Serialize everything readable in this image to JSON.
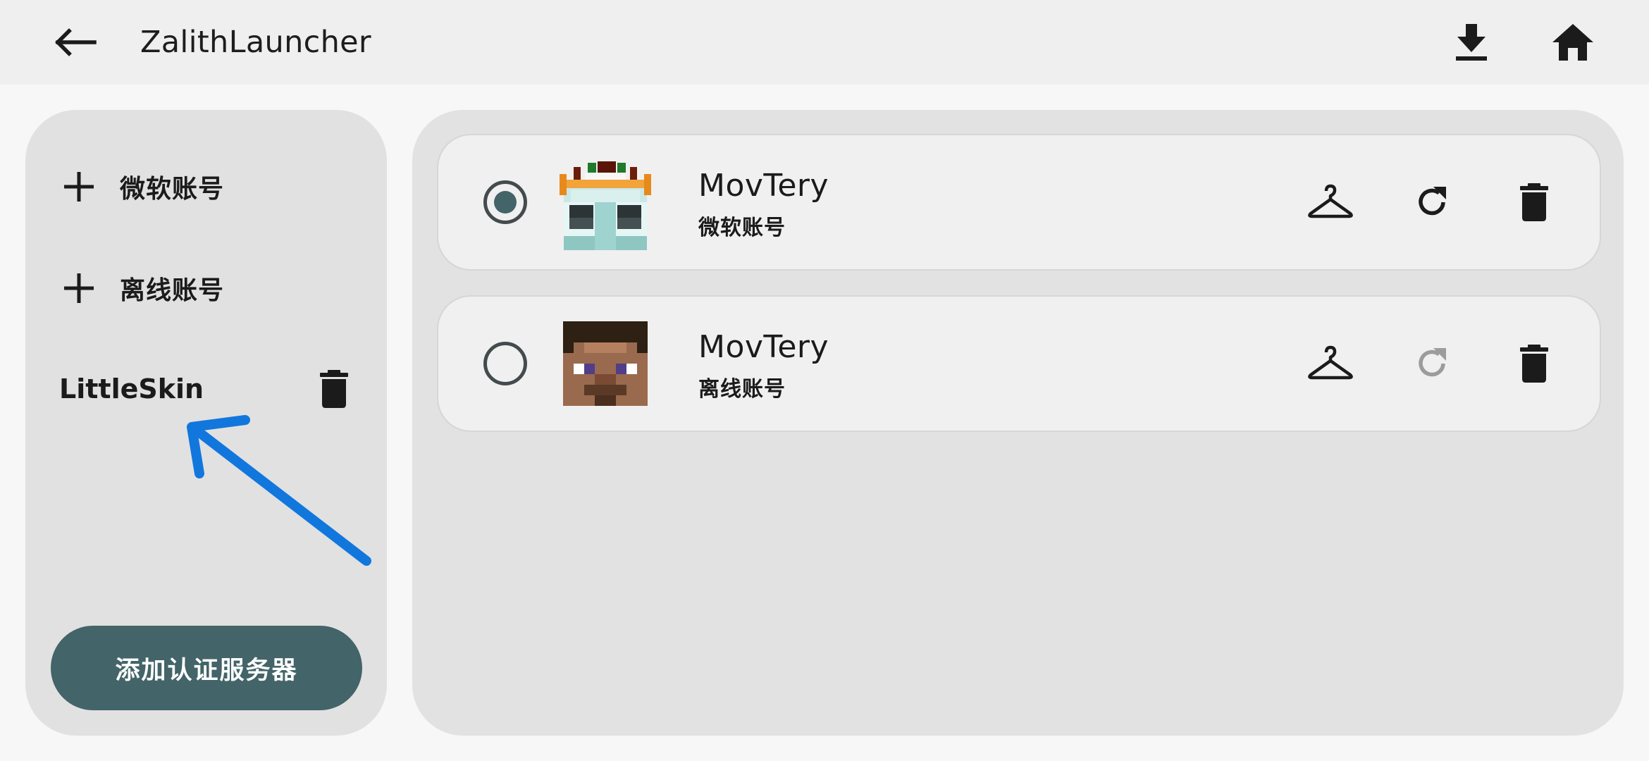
{
  "app": {
    "title": "ZalithLauncher"
  },
  "colors": {
    "primary": "#436468",
    "topbar_bg": "#efefef",
    "panel_bg": "#e1e1e1",
    "card_bg": "#f0f0f0",
    "annotation_arrow": "#1177dd"
  },
  "toolbar": {
    "back_icon": "arrow-left-icon",
    "download_icon": "download-icon",
    "home_icon": "home-icon"
  },
  "sidebar": {
    "add_items": [
      {
        "icon": "plus-icon",
        "label": "微软账号"
      },
      {
        "icon": "plus-icon",
        "label": "离线账号"
      }
    ],
    "servers": [
      {
        "name": "LittleSkin",
        "delete_icon": "trash-icon"
      }
    ],
    "add_server_label": "添加认证服务器"
  },
  "accounts": [
    {
      "name": "MovTery",
      "type": "微软账号",
      "selected": true,
      "refresh_enabled": true
    },
    {
      "name": "MovTery",
      "type": "离线账号",
      "selected": false,
      "refresh_enabled": false
    }
  ]
}
